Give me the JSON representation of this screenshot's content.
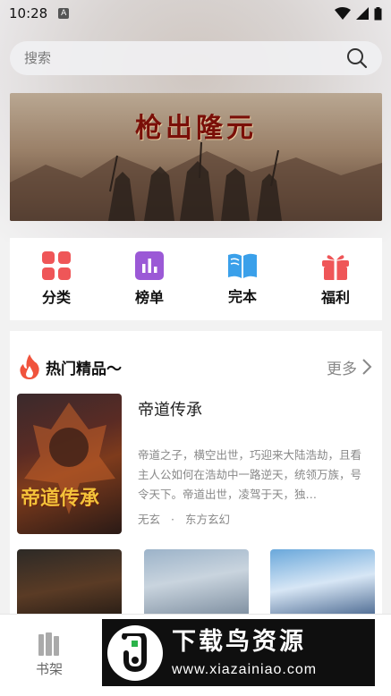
{
  "status": {
    "time": "10:28",
    "badge": "A"
  },
  "search": {
    "placeholder": "搜索"
  },
  "banner": {
    "title": "枪出隆元"
  },
  "grid": [
    {
      "label": "分类",
      "icon": "category-icon",
      "color": "#ef5658"
    },
    {
      "label": "榜单",
      "icon": "ranking-icon",
      "color": "#9b59d6"
    },
    {
      "label": "完本",
      "icon": "book-icon",
      "color": "#3aa0ea"
    },
    {
      "label": "福利",
      "icon": "gift-icon",
      "color": "#ef5658"
    }
  ],
  "hot": {
    "title": "热门精品～",
    "more": "更多",
    "featured": {
      "cover_title": "帝道传承",
      "name": "帝道传承",
      "desc": "帝道之子，横空出世，巧迎来大陆浩劫，且看主人公如何在浩劫中一路逆天，统领万族，号令天下。帝道出世，凌驾于天，独…",
      "author": "无玄",
      "sep": "·",
      "genre": "东方玄幻"
    }
  },
  "nav": {
    "shelf_label": "书架"
  },
  "watermark": {
    "title": "下载鸟资源",
    "url": "www.xiazainiao.com"
  }
}
